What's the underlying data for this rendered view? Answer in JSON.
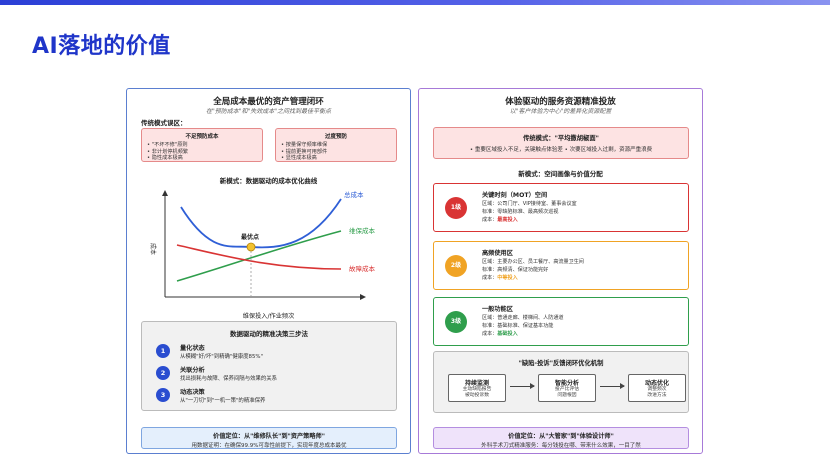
{
  "page": {
    "title": "AI落地的价值"
  },
  "left": {
    "title": "全局成本最优的资产管理闭环",
    "subtitle": "在\"预防成本\"和\"失效成本\"之间找到最佳平衡点",
    "trad_label": "传统模式误区：",
    "box1": {
      "title": "不足预防成本",
      "lines": [
        "• \"不坏不修\"原则",
        "• 非计划停机频繁",
        "• 隐性成本极高"
      ]
    },
    "box2": {
      "title": "过度预防",
      "lines": [
        "• 按量保守频率维保",
        "• 提前更换可用部件",
        "• 显性成本极高"
      ]
    },
    "new_label": "新模式：数据驱动的成本优化曲线",
    "chart": {
      "total_label": "总成本",
      "maint_label": "维保成本",
      "fail_label": "故障成本",
      "opt_label": "最优点",
      "ylabel": "成本",
      "xlabel": "维保投入/作业频次"
    },
    "steps": {
      "title": "数据驱动的精准决策三步法",
      "items": [
        {
          "num": "1",
          "title": "量化状态",
          "desc": "从模糊\"好/坏\"到精确\"健康度85%\""
        },
        {
          "num": "2",
          "title": "关联分析",
          "desc": "找出损耗与故障、保养间隔与效果的关系"
        },
        {
          "num": "3",
          "title": "动态决策",
          "desc": "从\"一刀切\"到\"一机一策\"的精准保养"
        }
      ]
    },
    "value": {
      "title": "价值定位：从\"维修队长\"到\"资产策略师\"",
      "desc": "用数据证明：在确保99.9%可靠性前提下，实现年度总成本最优"
    }
  },
  "right": {
    "title": "体验驱动的服务资源精准投放",
    "subtitle": "以\"客户体验为中心\"的差异化资源配置",
    "trad": {
      "title": "传统模式：\"平均撒胡椒面\"",
      "desc": "• 重要区域投入不足，关键触点体验差 • 次要区域投入过剩，资源严重浪费"
    },
    "new_label": "新模式：空间画像与价值分配",
    "tiers": [
      {
        "badge": "1级",
        "name": "关键时刻（MOT）空间",
        "area": "区域：公司门厅、VIP接待室、董事会议室",
        "standard": "标准：零缺陷标准、最高频次巡视",
        "cost_prefix": "成本：",
        "cost": "最高投入",
        "color": "#d93434"
      },
      {
        "badge": "2级",
        "name": "高频使用区",
        "area": "区域：主要办公区、员工餐厅、高流量卫生间",
        "standard": "标准：高频清、保证功能完好",
        "cost_prefix": "成本：",
        "cost": "中等投入",
        "color": "#f0a324"
      },
      {
        "badge": "3级",
        "name": "一般功能区",
        "area": "区域：普通走廊、楼梯间、人防通道",
        "standard": "标准：基础标准、保证基本功能",
        "cost_prefix": "成本：",
        "cost": "基础投入",
        "color": "#2f9e4c"
      }
    ],
    "mech": {
      "title": "\"缺陷-投诉\"反馈闭环优化机制",
      "steps": [
        {
          "title": "持续监测",
          "lines": [
            "主动缺陷报告",
            "被动投诉数"
          ]
        },
        {
          "title": "智能分析",
          "lines": [
            "投产比评估",
            "问题根因"
          ]
        },
        {
          "title": "动态优化",
          "lines": [
            "调整频次",
            "改进方法"
          ]
        }
      ]
    },
    "value": {
      "title": "价值定位：从\"大管家\"到\"体验设计师\"",
      "desc": "外科手术刀式精准服务：每分钱投在哪、带来什么效果，一目了然"
    }
  }
}
